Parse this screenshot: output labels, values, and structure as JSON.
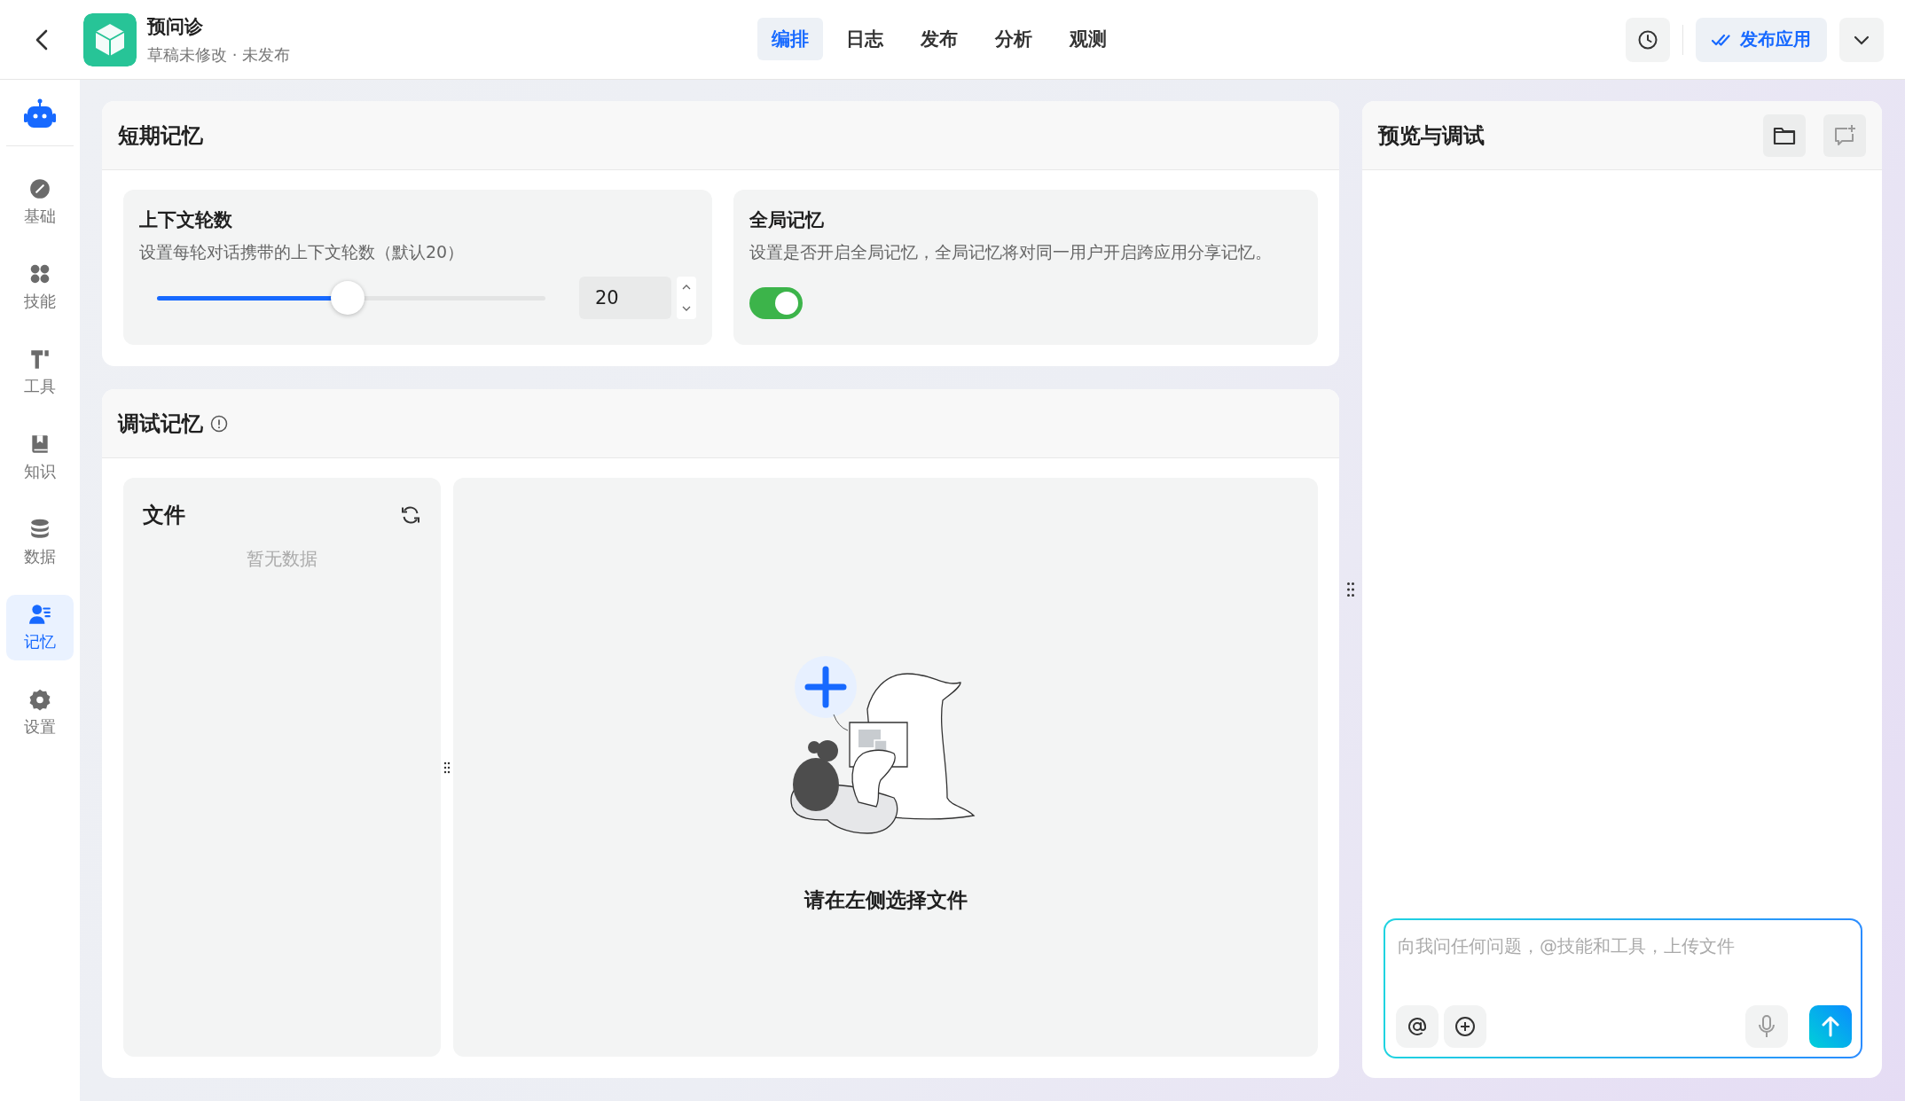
{
  "header": {
    "app_name": "预问诊",
    "status": "草稿未修改 · 未发布",
    "publish_button": "发布应用"
  },
  "tabs": [
    {
      "label": "编排",
      "selected": true
    },
    {
      "label": "日志",
      "selected": false
    },
    {
      "label": "发布",
      "selected": false
    },
    {
      "label": "分析",
      "selected": false
    },
    {
      "label": "观测",
      "selected": false
    }
  ],
  "sidebar": {
    "items": [
      {
        "kind": "basic",
        "label": "基础",
        "selected": false
      },
      {
        "kind": "skills",
        "label": "技能",
        "selected": false
      },
      {
        "kind": "tools",
        "label": "工具",
        "selected": false
      },
      {
        "kind": "knowledge",
        "label": "知识",
        "selected": false
      },
      {
        "kind": "data",
        "label": "数据",
        "selected": false
      },
      {
        "kind": "memory",
        "label": "记忆",
        "selected": true
      },
      {
        "kind": "settings",
        "label": "设置",
        "selected": false
      }
    ]
  },
  "short_memory": {
    "title": "短期记忆",
    "context_rounds": {
      "title": "上下文轮数",
      "description": "设置每轮对话携带的上下文轮数（默认20）",
      "level": 0.49,
      "value": "20"
    },
    "global_memory": {
      "title": "全局记忆",
      "description": "设置是否开启全局记忆，全局记忆将对同一用户开启跨应用分享记忆。",
      "on": true
    }
  },
  "debug_memory": {
    "title": "调试记忆",
    "files": {
      "title": "文件",
      "empty": "暂无数据"
    },
    "prompt": "请在左侧选择文件"
  },
  "preview": {
    "title": "预览与调试",
    "input": {
      "placeholder": "向我问任何问题，@技能和工具，上传文件"
    }
  }
}
